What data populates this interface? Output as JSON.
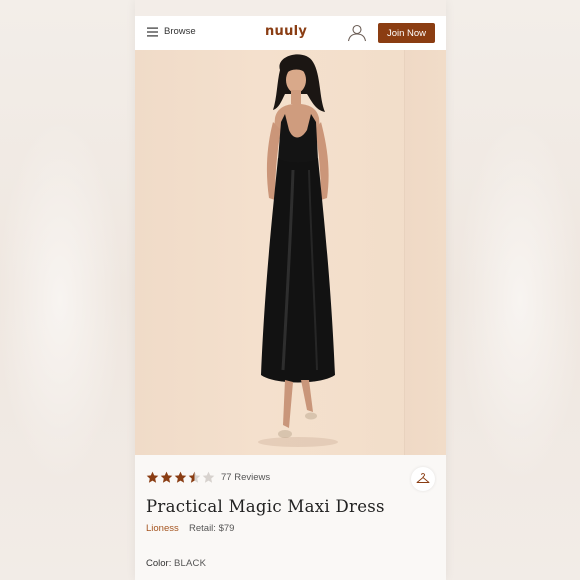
{
  "header": {
    "browse_label": "Browse",
    "logo_text": "nuuly",
    "join_label": "Join Now"
  },
  "product": {
    "image_icon": "product-photo",
    "rating": 3.5,
    "rating_max": 5,
    "reviews_text": "77 Reviews",
    "title": "Practical Magic Maxi Dress",
    "brand": "Lioness",
    "retail_text": "Retail: $79",
    "color_label": "Color:",
    "color_value": "BLACK"
  },
  "colors": {
    "brand_accent": "#8b3d12",
    "brand_link": "#a5541f",
    "star_filled": "#8a3d13",
    "star_empty": "#d7d2ce"
  },
  "icons": {
    "menu": "hamburger-icon",
    "account": "user-icon",
    "closet": "hanger-icon",
    "rating": "star-icon"
  }
}
